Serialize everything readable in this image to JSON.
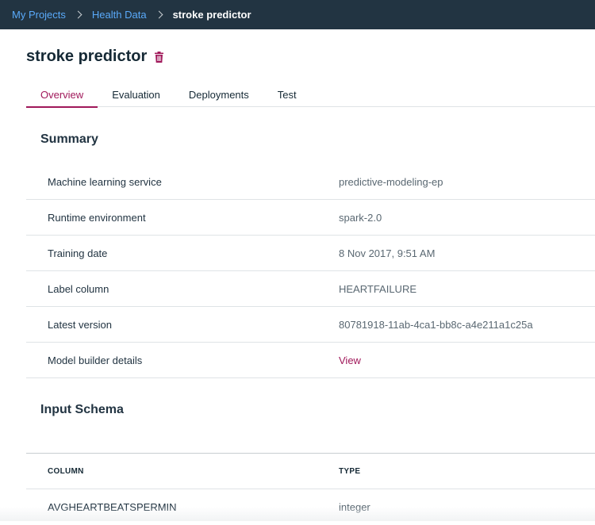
{
  "breadcrumb": {
    "items": [
      "My Projects",
      "Health Data"
    ],
    "current": "stroke predictor"
  },
  "page": {
    "title": "stroke predictor",
    "delete_icon": "trash-icon"
  },
  "tabs": [
    "Overview",
    "Evaluation",
    "Deployments",
    "Test"
  ],
  "summary": {
    "title": "Summary",
    "rows": [
      {
        "label": "Machine learning service",
        "value": "predictive-modeling-ep"
      },
      {
        "label": "Runtime environment",
        "value": "spark-2.0"
      },
      {
        "label": "Training date",
        "value": "8 Nov 2017, 9:51 AM"
      },
      {
        "label": "Label column",
        "value": "HEARTFAILURE"
      },
      {
        "label": "Latest version",
        "value": "80781918-11ab-4ca1-bb8c-a4e211a1c25a"
      },
      {
        "label": "Model builder details",
        "value": "View"
      }
    ]
  },
  "schema": {
    "title": "Input Schema",
    "headers": [
      "COLUMN",
      "TYPE"
    ],
    "rows": [
      {
        "column": "AVGHEARTBEATSPERMIN",
        "type": "integer"
      }
    ]
  },
  "colors": {
    "topbar": "#223442",
    "link": "#5aaafa",
    "accent": "#a0185a"
  }
}
